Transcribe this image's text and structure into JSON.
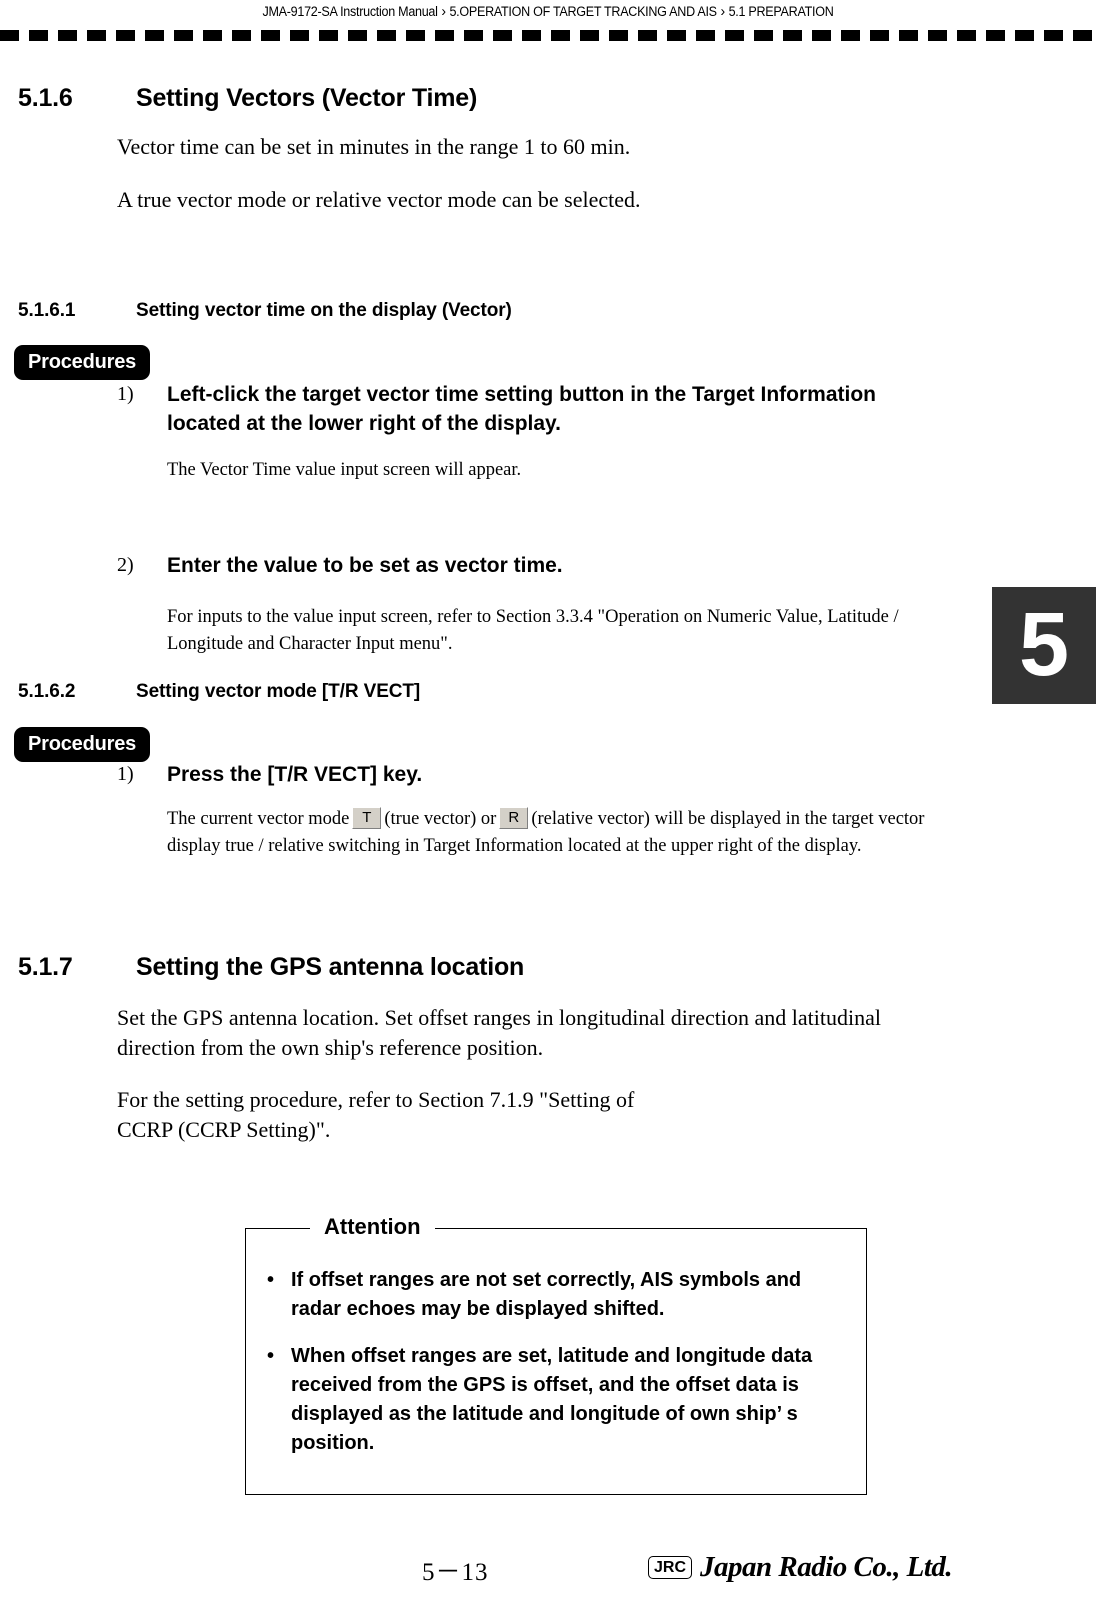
{
  "header": {
    "breadcrumb": [
      "JMA-9172-SA Instruction Manual",
      "5.OPERATION OF TARGET TRACKING AND AIS",
      "5.1  PREPARATION"
    ],
    "separator": "›"
  },
  "chapter_tab": {
    "number": "5"
  },
  "sections": {
    "s516": {
      "number": "5.1.6",
      "title": "Setting Vectors (Vector Time)",
      "para1": "Vector time can be set in minutes in the range 1 to 60 min.",
      "para2": "A true vector mode or relative vector mode can be selected."
    },
    "s5161": {
      "number": "5.1.6.1",
      "title": "Setting vector time on the display (Vector)",
      "procedures_label": "Procedures",
      "step1_num": "1)",
      "step1_text": "Left-click the target vector time setting button in the Target Information located at the lower right of the display.",
      "step1_note": "The Vector Time value input screen will appear.",
      "step2_num": "2)",
      "step2_text": "Enter the value to be set as vector time.",
      "step2_note": "For inputs to the value input screen, refer to Section 3.3.4 \"Operation on Numeric Value, Latitude / Longitude and Character Input menu\"."
    },
    "s5162": {
      "number": "5.1.6.2",
      "title": "Setting vector mode [T/R VECT]",
      "procedures_label": "Procedures",
      "step1_num": "1)",
      "step1_text": "Press the [T/R VECT] key.",
      "note_part1": "The current vector mode",
      "key_true": "T",
      "note_part2": "(true vector) or",
      "key_relative": "R",
      "note_part3": "(relative vector) will be displayed in the target vector display true / relative switching in Target Information located at the upper right of the display."
    },
    "s517": {
      "number": "5.1.7",
      "title": "Setting the GPS antenna location",
      "para1": "Set the GPS antenna location. Set offset ranges in longitudinal direction and latitudinal direction from the own ship's reference position.",
      "para2": "For the setting procedure, refer to Section 7.1.9 \"Setting of CCRP (CCRP Setting)\"."
    }
  },
  "attention": {
    "label": "Attention",
    "bullet_glyph": "•",
    "items": [
      "If offset ranges are not set correctly, AIS symbols and radar echoes may be displayed shifted.",
      "When offset ranges are set, latitude and longitude data received from the GPS is offset, and the offset data is displayed as the latitude and longitude of own ship’ s position."
    ]
  },
  "footer": {
    "page_number": "5－13",
    "logo_mark": "JRC",
    "logo_name": "Japan Radio Co., Ltd."
  }
}
